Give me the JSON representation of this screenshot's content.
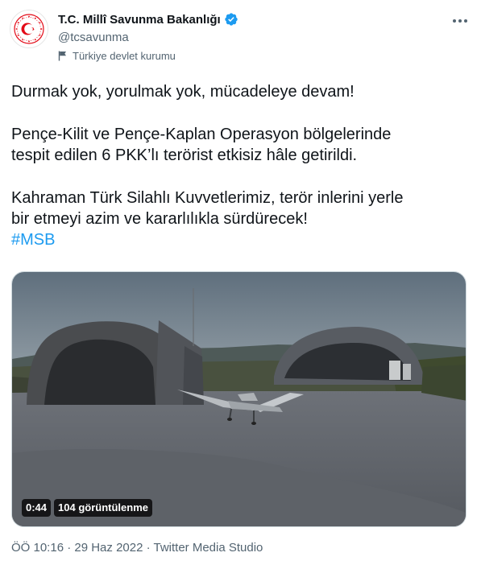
{
  "account": {
    "display_name": "T.C. Millî Savunma Bakanlığı",
    "handle": "@tcsavunma",
    "label": "Türkiye devlet kurumu",
    "verified_icon": "verified-badge-icon"
  },
  "tweet": {
    "line1": "Durmak yok, yorulmak yok, mücadeleye devam!",
    "para2_line1": "Pençe-Kilit ve Pençe-Kaplan Operasyon bölgelerinde",
    "para2_line2": "tespit edilen 6 PKK’lı terörist etkisiz hâle getirildi.",
    "para3_line1": "Kahraman Türk Silahlı Kuvvetlerimiz, terör inlerini yerle",
    "para3_line2": "bir etmeyi azim ve kararlılıkla sürdürecek!",
    "hashtag": "#MSB"
  },
  "media": {
    "duration": "0:44",
    "views": "104 görüntülenme"
  },
  "meta": {
    "timestamp": "ÖÖ 10:16 · 29 Haz 2022 · Twitter Media Studio"
  },
  "colors": {
    "accent": "#1d9bf0",
    "emblem_red": "#e30a17"
  }
}
